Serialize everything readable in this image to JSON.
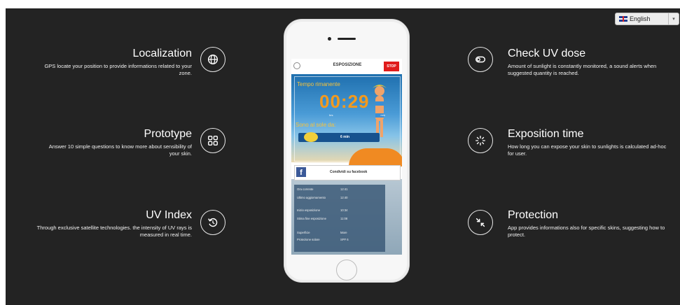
{
  "language": {
    "selected": "English"
  },
  "features": {
    "localization": {
      "title": "Localization",
      "desc": "GPS locate your position to provide informations related to your zone.",
      "icon": "globe-icon"
    },
    "prototype": {
      "title": "Prototype",
      "desc": "Answer 10 simple questions to know more about sensibility of your skin.",
      "icon": "grid-icon"
    },
    "uv_index": {
      "title": "UV Index",
      "desc": "Through exclusive satellite technologies. the intensity of UV rays is measured in real time.",
      "icon": "refresh-icon"
    },
    "check_uv_dose": {
      "title": "Check UV dose",
      "desc": "Amount of sunlight is constantly monitored, a sound alerts when suggested quantity is reached.",
      "icon": "toggle-icon"
    },
    "exposition_time": {
      "title": "Exposition time",
      "desc": "How long you can expose your skin to sunlights is calculated ad-hoc for user.",
      "icon": "loading-icon"
    },
    "protection": {
      "title": "Protection",
      "desc": "App provides informations also for specific skins, suggesting how to protect.",
      "icon": "shrink-icon"
    }
  },
  "phone": {
    "header_title": "ESPOSIZIONE",
    "stop_label": "STOP",
    "time_label": "Tempo rimanente",
    "timer": "00:29",
    "unit_left": "hrs",
    "unit_right": "min",
    "sun_label": "Sono al sole da:",
    "minutes": "6 min",
    "share_label": "Condividi su facebook",
    "info_rows": [
      {
        "k": "Ora corrente",
        "v": "12:41"
      },
      {
        "k": "Ultimo aggiornamento",
        "v": "12:40"
      },
      {
        "k": "Inizio esposizione",
        "v": "10:34"
      },
      {
        "k": "Stima fine esposizione",
        "v": "11:08"
      },
      {
        "k": "Superficie",
        "v": "Mare"
      },
      {
        "k": "Protezione solare",
        "v": "SPF 6"
      }
    ]
  },
  "colors": {
    "background": "#232323",
    "stop": "#e01c1c",
    "timer": "#f39a1e",
    "facebook": "#3b5998"
  }
}
